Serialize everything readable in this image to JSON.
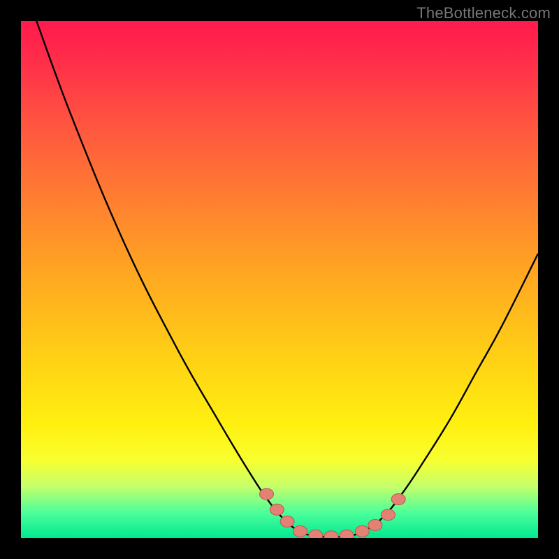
{
  "watermark": "TheBottleneck.com",
  "colors": {
    "frame": "#000000",
    "curve_stroke": "#000000",
    "marker_fill": "#e58074",
    "marker_stroke": "#b55a50",
    "watermark": "#777777"
  },
  "chart_data": {
    "type": "line",
    "title": "",
    "xlabel": "",
    "ylabel": "",
    "xlim": [
      0,
      100
    ],
    "ylim": [
      0,
      100
    ],
    "grid": false,
    "legend": false,
    "series": [
      {
        "name": "bottleneck-curve",
        "x": [
          3,
          10,
          20,
          30,
          38,
          44,
          48,
          51,
          54,
          57,
          60,
          63,
          66,
          70,
          74,
          78,
          83,
          88,
          93,
          100
        ],
        "y": [
          100,
          81,
          57,
          37,
          23,
          13,
          7,
          3.5,
          1.2,
          0.4,
          0.2,
          0.4,
          1.2,
          4,
          9,
          15,
          23,
          32,
          41,
          55
        ]
      }
    ],
    "markers": {
      "name": "highlight-dots",
      "x": [
        47.5,
        49.5,
        51.5,
        54,
        57,
        60,
        63,
        66,
        68.5,
        71,
        73
      ],
      "y": [
        8.5,
        5.5,
        3.2,
        1.3,
        0.5,
        0.3,
        0.5,
        1.3,
        2.5,
        4.5,
        7.5
      ]
    },
    "gradient_stops": [
      {
        "pos": 0,
        "color": "#ff1a4d"
      },
      {
        "pos": 20,
        "color": "#ff5540"
      },
      {
        "pos": 50,
        "color": "#ffaa20"
      },
      {
        "pos": 78,
        "color": "#fff010"
      },
      {
        "pos": 95,
        "color": "#4eff9a"
      },
      {
        "pos": 100,
        "color": "#00e98f"
      }
    ]
  }
}
